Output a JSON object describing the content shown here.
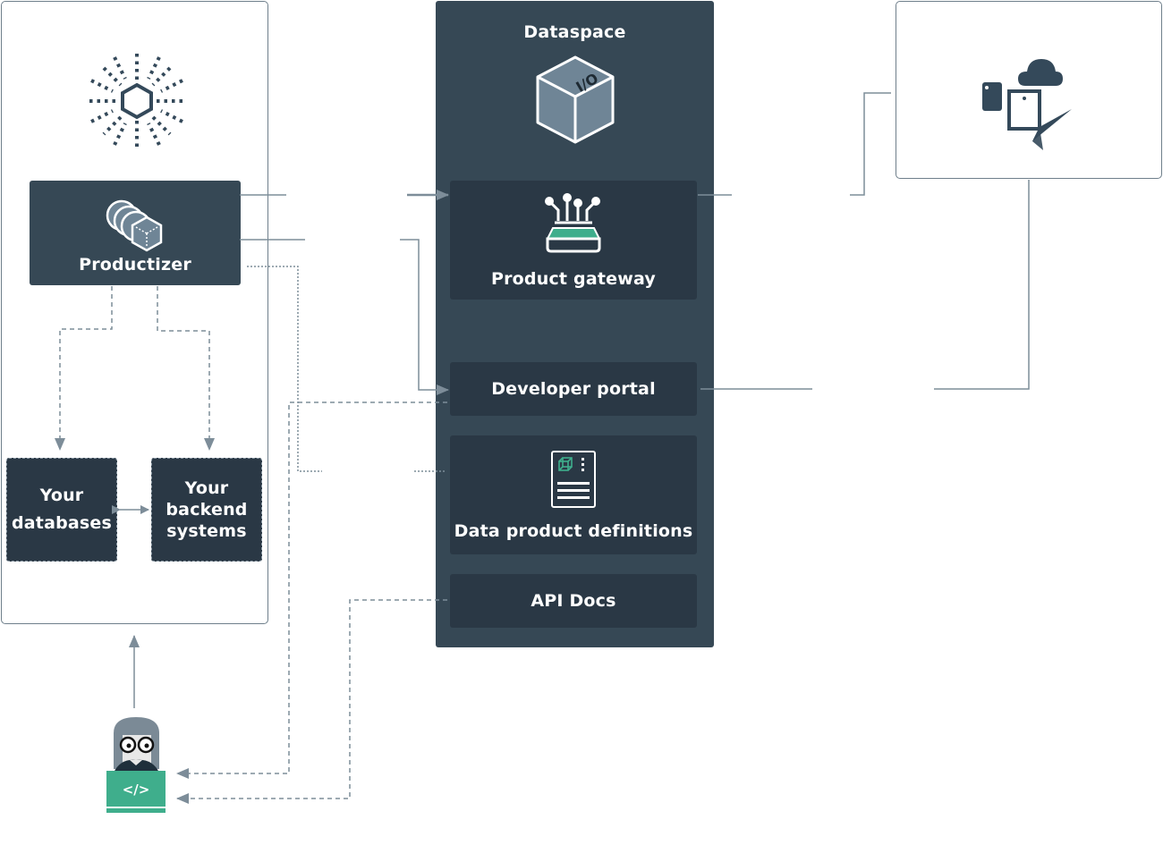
{
  "left_zone": {
    "productizer": {
      "label": "Productizer"
    },
    "databases": {
      "label": "Your databases"
    },
    "backend": {
      "label": "Your backend systems"
    }
  },
  "dataspace": {
    "title": "Dataspace",
    "cube_text": "I/O",
    "product_gateway": {
      "label": "Product gateway"
    },
    "developer_portal": {
      "label": "Developer portal"
    },
    "data_product_definitions": {
      "label": "Data product definitions"
    },
    "api_docs": {
      "label": "API Docs"
    }
  },
  "developer": {
    "laptop_text": "</>"
  },
  "colors": {
    "panel": "#364855",
    "inner": "#2a3845",
    "accent": "#3fae8c",
    "line": "#7d8d99"
  }
}
